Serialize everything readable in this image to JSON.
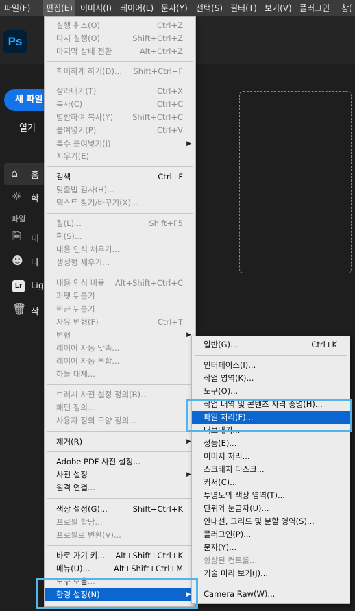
{
  "menubar": {
    "items": [
      "파일(F)",
      "편집(E)",
      "이미지(I)",
      "레이어(L)",
      "문자(Y)",
      "선택(S)",
      "필터(T)",
      "보기(V)",
      "플러그인",
      "창("
    ],
    "active_index": 1
  },
  "app": {
    "logo_text": "Ps",
    "new_file": "새 파일",
    "open": "열기",
    "sidebar": {
      "home": "홈",
      "learn": "학",
      "section_label": "파일",
      "items": [
        "내",
        "나",
        "Lig",
        "삭"
      ],
      "lr_badge": "Lr"
    }
  },
  "edit_menu": {
    "items": [
      {
        "label": "실행 취소(O)",
        "shortcut": "Ctrl+Z",
        "disabled": true
      },
      {
        "label": "다시 실행(O)",
        "shortcut": "Shift+Ctrl+Z",
        "disabled": true
      },
      {
        "label": "마지막 상태 전환",
        "shortcut": "Alt+Ctrl+Z",
        "disabled": true
      },
      {
        "label": "희미하게 하기(D)...",
        "shortcut": "Shift+Ctrl+F",
        "disabled": true
      },
      {
        "label": "잘라내기(T)",
        "shortcut": "Ctrl+X",
        "disabled": true
      },
      {
        "label": "복사(C)",
        "shortcut": "Ctrl+C",
        "disabled": true
      },
      {
        "label": "병합하여 복사(Y)",
        "shortcut": "Shift+Ctrl+C",
        "disabled": true
      },
      {
        "label": "붙여넣기(P)",
        "shortcut": "Ctrl+V",
        "disabled": true
      },
      {
        "label": "특수 붙여넣기(I)",
        "shortcut": "",
        "disabled": true,
        "submenu": true
      },
      {
        "label": "지우기(E)",
        "shortcut": "",
        "disabled": true
      },
      {
        "label": "검색",
        "shortcut": "Ctrl+F",
        "disabled": false
      },
      {
        "label": "맞춤법 검사(H)...",
        "shortcut": "",
        "disabled": true
      },
      {
        "label": "텍스트 찾기/바꾸기(X)...",
        "shortcut": "",
        "disabled": true
      },
      {
        "label": "칠(L)...",
        "shortcut": "Shift+F5",
        "disabled": true
      },
      {
        "label": "획(S)...",
        "shortcut": "",
        "disabled": true
      },
      {
        "label": "내용 인식 채우기...",
        "shortcut": "",
        "disabled": true
      },
      {
        "label": "생성형 채우기...",
        "shortcut": "",
        "disabled": true
      },
      {
        "label": "내용 인식 비율",
        "shortcut": "Alt+Shift+Ctrl+C",
        "disabled": true
      },
      {
        "label": "퍼펫 뒤틀기",
        "shortcut": "",
        "disabled": true
      },
      {
        "label": "원근 뒤틀기",
        "shortcut": "",
        "disabled": true
      },
      {
        "label": "자유 변형(F)",
        "shortcut": "Ctrl+T",
        "disabled": true
      },
      {
        "label": "변형",
        "shortcut": "",
        "disabled": true,
        "submenu": true
      },
      {
        "label": "레이어 자동 맞춤...",
        "shortcut": "",
        "disabled": true
      },
      {
        "label": "레이어 자동 혼합...",
        "shortcut": "",
        "disabled": true
      },
      {
        "label": "하늘 대체...",
        "shortcut": "",
        "disabled": true
      },
      {
        "label": "브러시 사전 설정 정의(B)...",
        "shortcut": "",
        "disabled": true
      },
      {
        "label": "패턴 정의...",
        "shortcut": "",
        "disabled": true
      },
      {
        "label": "사용자 정의 모양 정의...",
        "shortcut": "",
        "disabled": true
      },
      {
        "label": "제거(R)",
        "shortcut": "",
        "disabled": false,
        "submenu": true
      },
      {
        "label": "Adobe PDF 사전 설정...",
        "shortcut": "",
        "disabled": false
      },
      {
        "label": "사전 설정",
        "shortcut": "",
        "disabled": false,
        "submenu": true
      },
      {
        "label": "원격 연결...",
        "shortcut": "",
        "disabled": false
      },
      {
        "label": "색상 설정(G)...",
        "shortcut": "Shift+Ctrl+K",
        "disabled": false
      },
      {
        "label": "프로필 할당...",
        "shortcut": "",
        "disabled": true
      },
      {
        "label": "프로필로 변환(V)...",
        "shortcut": "",
        "disabled": true
      },
      {
        "label": "바로 가기 키...",
        "shortcut": "Alt+Shift+Ctrl+K",
        "disabled": false
      },
      {
        "label": "메뉴(U)...",
        "shortcut": "Alt+Shift+Ctrl+M",
        "disabled": false
      },
      {
        "label": "도구 모음...",
        "shortcut": "",
        "disabled": false
      },
      {
        "label": "환경 설정(N)",
        "shortcut": "",
        "disabled": false,
        "submenu": true,
        "highlighted": true
      }
    ]
  },
  "pref_menu": {
    "items": [
      {
        "label": "일반(G)...",
        "shortcut": "Ctrl+K",
        "disabled": false
      },
      {
        "label": "인터페이스(I)...",
        "shortcut": "",
        "disabled": false
      },
      {
        "label": "작업 영역(K)...",
        "shortcut": "",
        "disabled": false
      },
      {
        "label": "도구(O)...",
        "shortcut": "",
        "disabled": false
      },
      {
        "label": "작업 내역 및 콘텐츠 자격 증명(H)...",
        "shortcut": "",
        "disabled": false
      },
      {
        "label": "파일 처리(F)...",
        "shortcut": "",
        "disabled": false,
        "highlighted": true
      },
      {
        "label": "내보내기...",
        "shortcut": "",
        "disabled": false
      },
      {
        "label": "성능(E)...",
        "shortcut": "",
        "disabled": false
      },
      {
        "label": "이미지 처리...",
        "shortcut": "",
        "disabled": false
      },
      {
        "label": "스크래치 디스크...",
        "shortcut": "",
        "disabled": false
      },
      {
        "label": "커서(C)...",
        "shortcut": "",
        "disabled": false
      },
      {
        "label": "투명도와 색상 영역(T)...",
        "shortcut": "",
        "disabled": false
      },
      {
        "label": "단위와 눈금자(U)...",
        "shortcut": "",
        "disabled": false
      },
      {
        "label": "안내선, 그리드 및 분할 영역(S)...",
        "shortcut": "",
        "disabled": false
      },
      {
        "label": "플러그인(P)...",
        "shortcut": "",
        "disabled": false
      },
      {
        "label": "문자(Y)...",
        "shortcut": "",
        "disabled": false
      },
      {
        "label": "향상된 컨트롤...",
        "shortcut": "",
        "disabled": true
      },
      {
        "label": "기술 미리 보기(J)...",
        "shortcut": "",
        "disabled": false
      },
      {
        "label": "Camera Raw(W)...",
        "shortcut": "",
        "disabled": false
      }
    ]
  },
  "colors": {
    "highlight": "#0b66d0",
    "callout": "#52b4e8",
    "primary_button": "#1473e6"
  }
}
